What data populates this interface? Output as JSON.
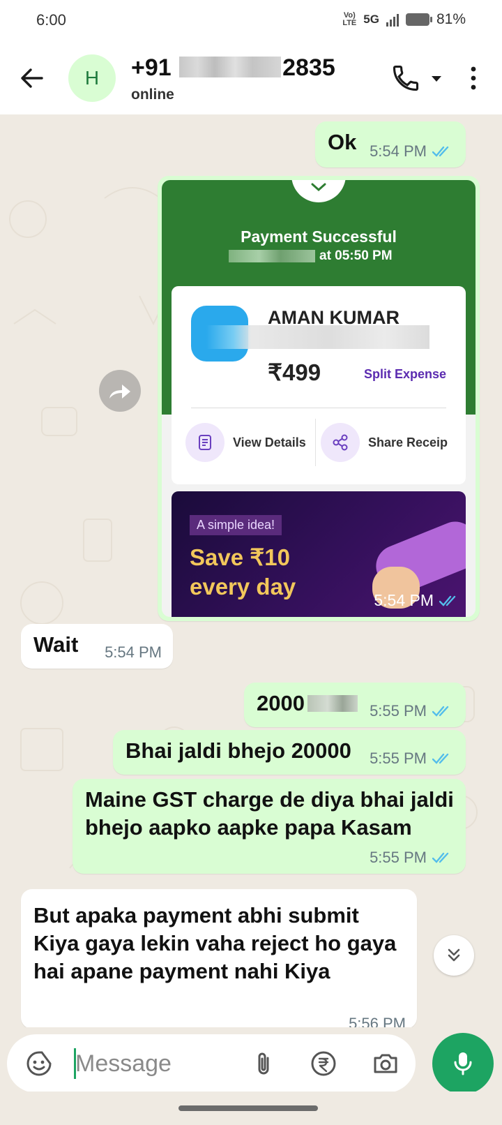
{
  "status_bar": {
    "time": "6:00",
    "network_tag": "Vo) LTE",
    "network": "5G",
    "battery": "81%"
  },
  "header": {
    "avatar_letter": "H",
    "contact_prefix": "+91",
    "contact_suffix": "2835",
    "contact_status": "online"
  },
  "messages": [
    {
      "text": "Ok",
      "time": "5:54 PM"
    },
    {
      "time": "5:54 PM"
    },
    {
      "text": "Wait",
      "time": "5:54 PM"
    },
    {
      "text": "2000",
      "time": "5:55 PM"
    },
    {
      "text": "Bhai jaldi bhejo 20000",
      "time": "5:55 PM"
    },
    {
      "text": "Maine GST charge de diya bhai jaldi bhejo aapko aapke papa Kasam",
      "time": "5:55 PM"
    },
    {
      "text": "But apaka payment abhi submit Kiya gaya lekin vaha reject ho gaya hai apane payment nahi Kiya",
      "time": "5:56 PM"
    }
  ],
  "receipt": {
    "title": "Payment Successful",
    "date_time": "at 05:50 PM",
    "payee": "AMAN KUMAR",
    "amount": "₹499",
    "split_label": "Split Expense",
    "view_details": "View Details",
    "share_receipt": "Share Receip",
    "banner_tag": "A simple idea!",
    "banner_line1": "Save ₹10",
    "banner_line2": "every day"
  },
  "composer": {
    "placeholder": "Message"
  },
  "colors": {
    "outgoing": "#d9fdd3",
    "incoming": "#ffffff",
    "accent": "#1da462",
    "ticks": "#53bdeb",
    "receipt_green": "#2e7d32"
  },
  "icons": [
    "back-arrow-icon",
    "phone-icon",
    "chevron-down-icon",
    "more-vertical-icon",
    "forward-icon",
    "receipt-icon",
    "share-icon",
    "double-chevron-down-icon",
    "sticker-icon",
    "attach-icon",
    "rupee-icon",
    "camera-icon",
    "mic-icon"
  ]
}
